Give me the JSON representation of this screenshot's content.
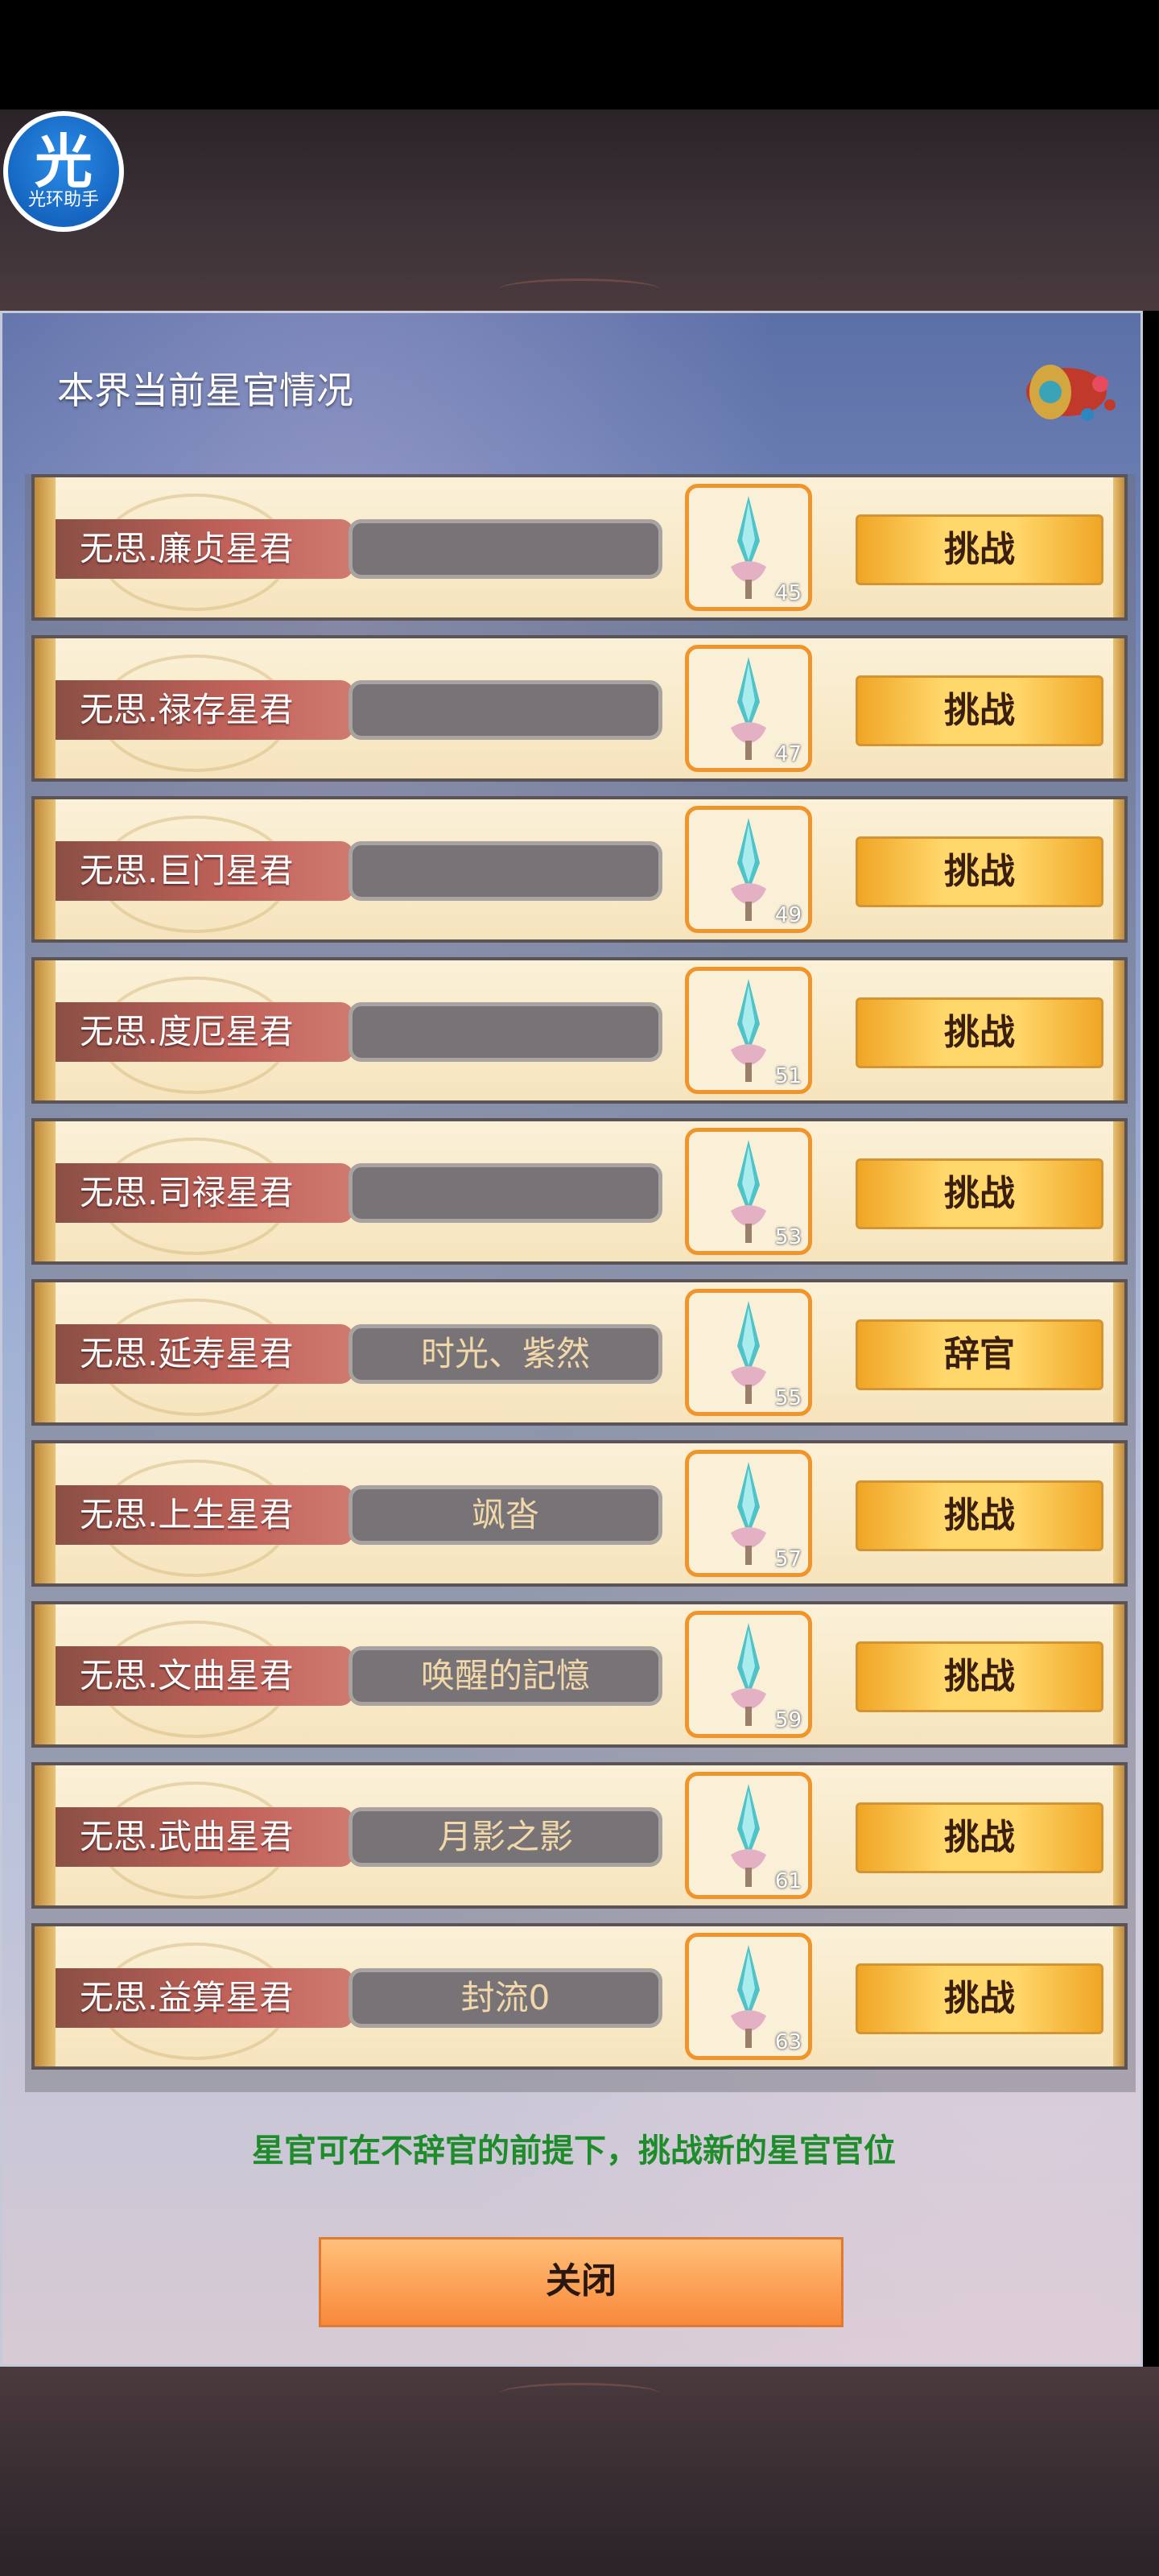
{
  "assistant": {
    "glyph": "光",
    "caption": "光环助手"
  },
  "panel": {
    "title": "本界当前星官情况"
  },
  "rows": [
    {
      "title": "无思.廉贞星君",
      "holder": "",
      "level": "45",
      "action": "挑战"
    },
    {
      "title": "无思.禄存星君",
      "holder": "",
      "level": "47",
      "action": "挑战"
    },
    {
      "title": "无思.巨门星君",
      "holder": "",
      "level": "49",
      "action": "挑战"
    },
    {
      "title": "无思.度厄星君",
      "holder": "",
      "level": "51",
      "action": "挑战"
    },
    {
      "title": "无思.司禄星君",
      "holder": "",
      "level": "53",
      "action": "挑战"
    },
    {
      "title": "无思.延寿星君",
      "holder": "时光、紫然",
      "level": "55",
      "action": "辞官"
    },
    {
      "title": "无思.上生星君",
      "holder": "飒沓",
      "level": "57",
      "action": "挑战"
    },
    {
      "title": "无思.文曲星君",
      "holder": "唤醒的記憶",
      "level": "59",
      "action": "挑战"
    },
    {
      "title": "无思.武曲星君",
      "holder": "月影之影",
      "level": "61",
      "action": "挑战"
    },
    {
      "title": "无思.益算星君",
      "holder": "封流0",
      "level": "63",
      "action": "挑战"
    }
  ],
  "tip": "星官可在不辞官的前提下，挑战新的星官官位",
  "close_label": "关闭",
  "colors": {
    "tip": "#1e8c2a",
    "button": "#ffd76a",
    "banner": "#c1625a"
  }
}
